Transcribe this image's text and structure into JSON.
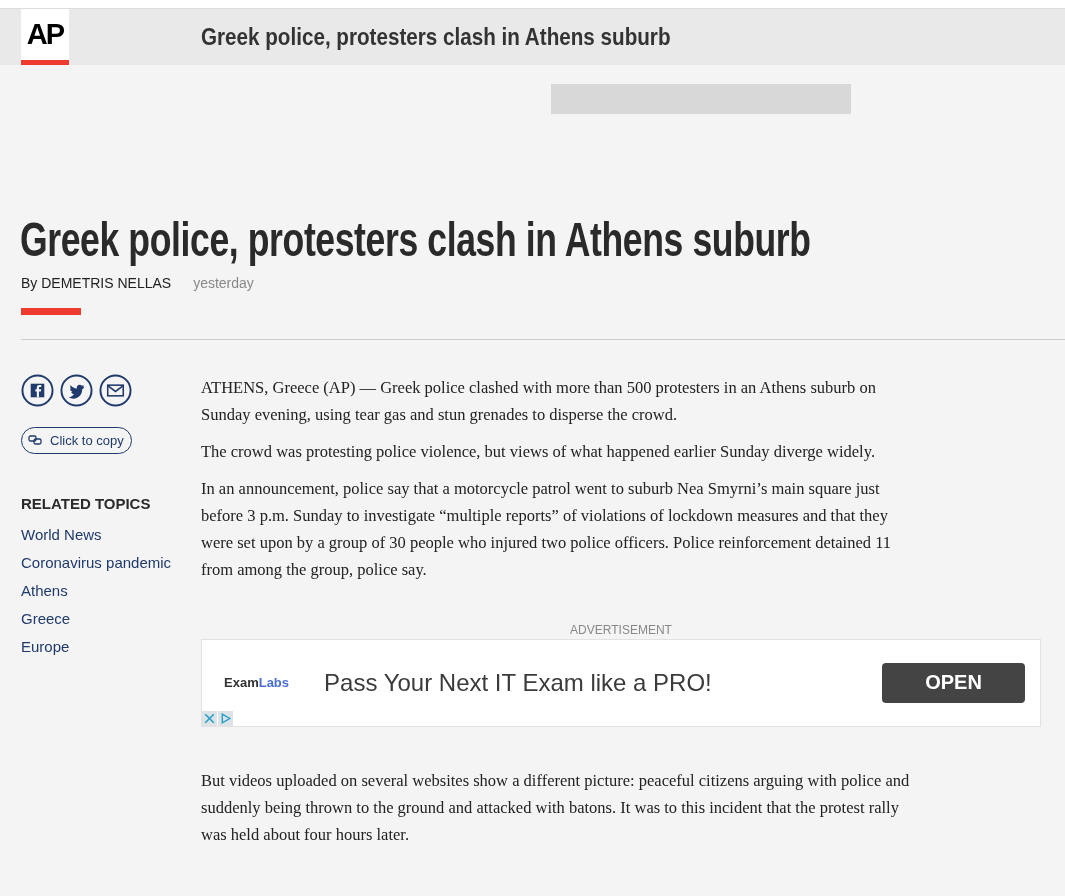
{
  "header": {
    "logo": "AP",
    "title": "Greek police, protesters clash in Athens suburb"
  },
  "article": {
    "headline": "Greek police, protesters clash in Athens suburb",
    "byline": "By DEMETRIS NELLAS",
    "time": "yesterday",
    "paragraphs_before_ad": [
      "ATHENS, Greece (AP) — Greek police clashed with more than 500 protesters in an Athens suburb on Sunday evening, using tear gas and stun grenades to disperse the crowd.",
      "The crowd was protesting police violence, but views of what happened earlier Sunday diverge widely.",
      "In an announcement, police say that a motorcycle patrol went to suburb Nea Smyrni’s main square just before 3 p.m. Sunday to investigate “multiple reports” of violations of lockdown measures and that they were set upon by a group of 30 people who injured two police officers. Police reinforcement detained 11 from among the group, police say."
    ],
    "paragraphs_after_ad": [
      "But videos uploaded on several websites show a different picture: peaceful citizens arguing with police and suddenly being thrown to the ground and attacked with batons. It was to this incident that the protest rally was held about four hours later."
    ]
  },
  "share": {
    "copy_label": "Click to copy"
  },
  "related_topics": {
    "title": "RELATED TOPICS",
    "items": [
      "World News",
      "Coronavirus pandemic",
      "Athens",
      "Greece",
      "Europe"
    ]
  },
  "ad": {
    "label": "ADVERTISEMENT",
    "brand_first": "Exam",
    "brand_second": "Labs",
    "text": "Pass Your Next IT Exam like a PRO!",
    "button": "OPEN"
  }
}
